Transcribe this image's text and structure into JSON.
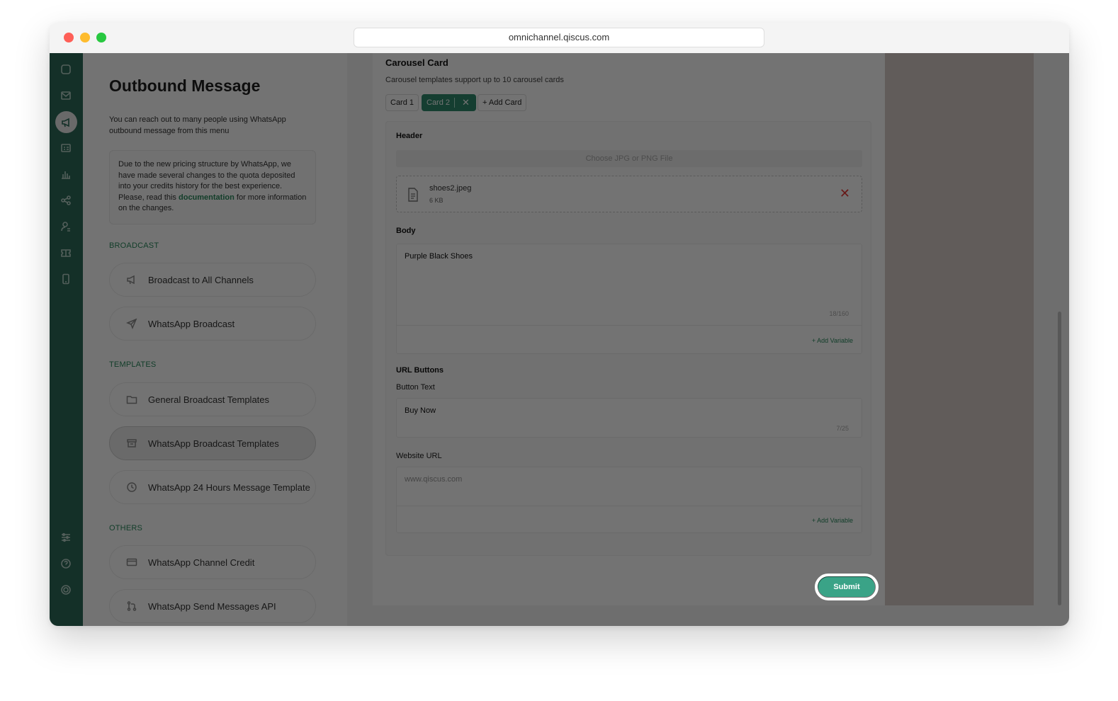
{
  "browser": {
    "url": "omnichannel.qiscus.com"
  },
  "rail": {
    "icons": [
      "chat-icon",
      "inbox-icon",
      "megaphone-icon",
      "contacts-icon",
      "analytics-icon",
      "integration-icon",
      "agent-icon",
      "ticket-icon",
      "mobile-icon",
      "settings-icon",
      "help-icon",
      "power-icon"
    ]
  },
  "left": {
    "title": "Outbound Message",
    "description": "You can reach out to many people using WhatsApp outbound message from this menu",
    "notice_before": "Due to the new pricing structure by WhatsApp, we have made several changes to the quota deposited into your credits history for the best experience. Please, read this ",
    "notice_link": "documentation",
    "notice_after": " for more information on the changes.",
    "sections": {
      "broadcast": "BROADCAST",
      "templates": "TEMPLATES",
      "others": "OTHERS"
    },
    "items": {
      "broadcast_all": "Broadcast to All Channels",
      "whatsapp_broadcast": "WhatsApp Broadcast",
      "general_templates": "General Broadcast Templates",
      "wa_templates": "WhatsApp Broadcast Templates",
      "wa_24h": "WhatsApp 24 Hours Message Template",
      "wa_credit": "WhatsApp Channel Credit",
      "wa_api": "WhatsApp Send Messages API"
    }
  },
  "carousel": {
    "title": "Carousel Card",
    "subtitle": "Carousel templates support up to 10 carousel cards",
    "tabs": {
      "card1": "Card 1",
      "card2": "Card 2",
      "add": "+ Add Card"
    },
    "header_label": "Header",
    "choose_file": "Choose JPG or PNG File",
    "file": {
      "name": "shoes2.jpeg",
      "size": "6 KB"
    },
    "body_label": "Body",
    "body_value": "Purple Black Shoes",
    "body_count": "18/160",
    "add_variable": "+ Add Variable",
    "url_buttons_label": "URL Buttons",
    "button_text_label": "Button Text",
    "button_text_value": "Buy Now",
    "button_text_count": "7/25",
    "website_url_label": "Website URL",
    "website_url_placeholder": "www.qiscus.com"
  },
  "submit_label": "Submit"
}
